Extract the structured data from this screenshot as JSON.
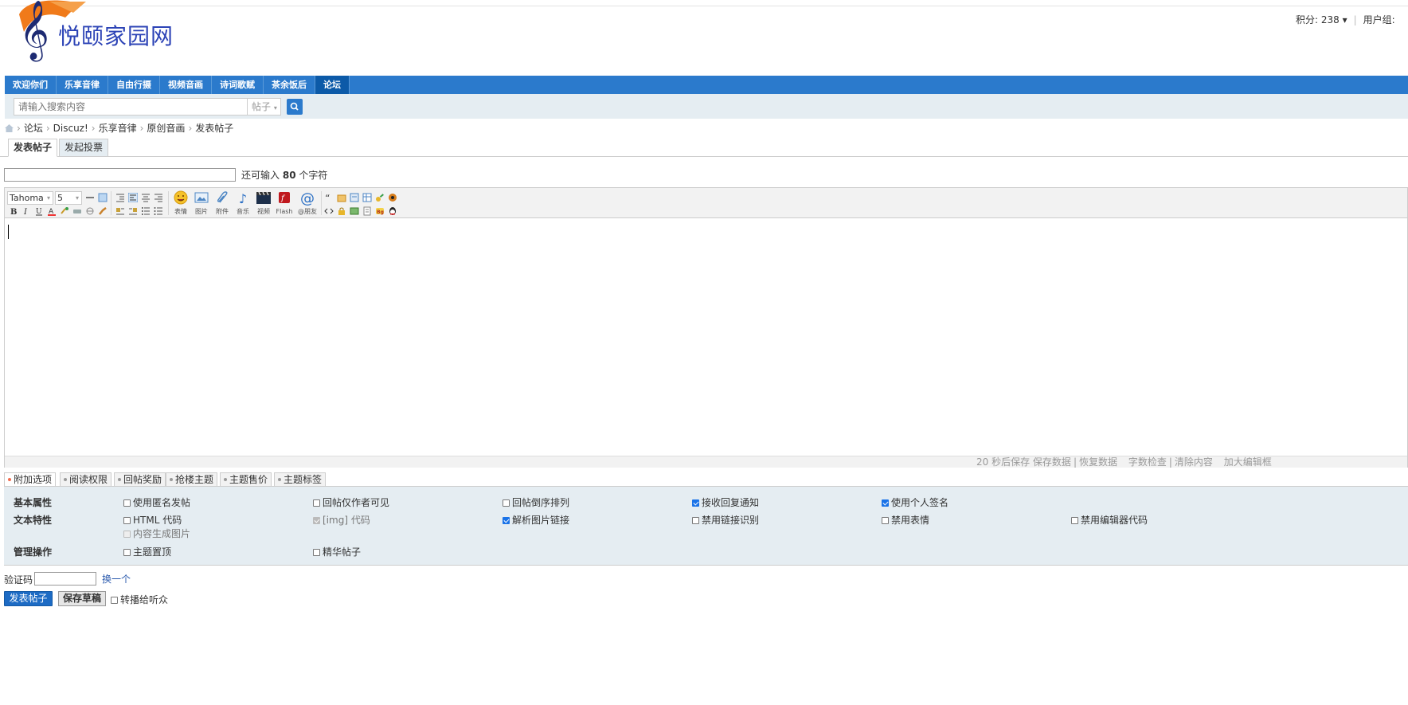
{
  "logo": {
    "name": "悦颐家园网"
  },
  "userinfo": {
    "points": "积分: 238",
    "group": "用户组: "
  },
  "nav": [
    {
      "label": "欢迎你们",
      "active": false
    },
    {
      "label": "乐享音律",
      "active": false
    },
    {
      "label": "自由行摄",
      "active": false
    },
    {
      "label": "视频音画",
      "active": false
    },
    {
      "label": "诗词歌赋",
      "active": false
    },
    {
      "label": "茶余饭后",
      "active": false
    },
    {
      "label": "论坛",
      "active": true
    }
  ],
  "search": {
    "placeholder": "请输入搜索内容",
    "type": "帖子"
  },
  "breadcrumb": [
    "论坛",
    "Discuz!",
    "乐享音律",
    "原创音画",
    "发表帖子"
  ],
  "tabs": [
    "发表帖子",
    "发起投票"
  ],
  "subject": {
    "remaining_prefix": "还可输入",
    "remaining_count": "80",
    "remaining_suffix": "个字符"
  },
  "editor": {
    "font": "Tahoma",
    "size": "5",
    "tools": [
      "表情",
      "图片",
      "附件",
      "音乐",
      "视频",
      "Flash",
      "@朋友"
    ],
    "status": {
      "autosave": "20 秒后保存",
      "save": "保存数据",
      "restore": "恢复数据",
      "check": "字数检查",
      "clear": "清除内容",
      "enlarge": "加大编辑框"
    }
  },
  "option_tabs": [
    "附加选项",
    "阅读权限",
    "回帖奖励",
    "抢楼主题",
    "主题售价",
    "主题标签"
  ],
  "options": {
    "basic": {
      "label": "基本属性",
      "items": [
        "使用匿名发帖",
        "回帖仅作者可见",
        "回帖倒序排列",
        "接收回复通知",
        "使用个人签名"
      ]
    },
    "text": {
      "label": "文本特性",
      "items": [
        "HTML 代码",
        "[img] 代码",
        "解析图片链接",
        "禁用链接识别",
        "禁用表情",
        "禁用编辑器代码",
        "内容生成图片"
      ]
    },
    "admin": {
      "label": "管理操作",
      "items": [
        "主题置顶",
        "精华帖子"
      ]
    }
  },
  "captcha": {
    "label": "验证码",
    "change": "换一个"
  },
  "actions": {
    "submit": "发表帖子",
    "draft": "保存草稿",
    "broadcast": "转播给听众"
  }
}
